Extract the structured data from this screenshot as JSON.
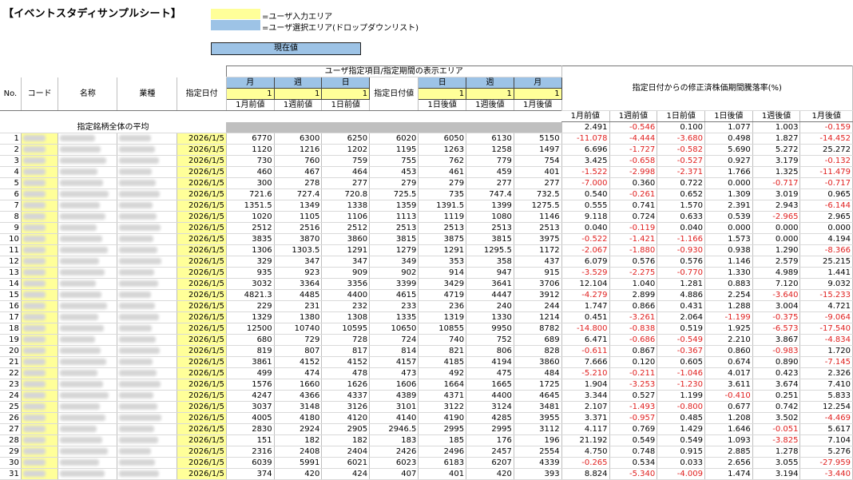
{
  "title": "【イベントスタディサンプルシート】",
  "legend": {
    "input_label": "=ユーザ入力エリア",
    "select_label": "=ユーザ選択エリア(ドロップダウンリスト)",
    "input_color": "#ffff99",
    "select_color": "#9dc3e6"
  },
  "current_button": "現在値",
  "header": {
    "area_title": "ユーザ指定項目/指定期間の表示エリア",
    "rate_title": "指定日付からの修正済株価期間騰落率(%)",
    "no": "No.",
    "code": "コード",
    "name": "名称",
    "industry": "業種",
    "date": "指定日付",
    "date_value": "指定日付値",
    "before_units": [
      "月",
      "週",
      "日"
    ],
    "after_units": [
      "日",
      "週",
      "月"
    ],
    "before_inputs": [
      "1",
      "1",
      "1"
    ],
    "after_inputs": [
      "1",
      "1",
      "1"
    ],
    "before_labels": [
      "1月前値",
      "1週前値",
      "1日前値"
    ],
    "after_labels": [
      "1日後値",
      "1週後値",
      "1月後値"
    ],
    "rate_labels": [
      "1月前値",
      "1週前値",
      "1日前値",
      "1日後値",
      "1週後値",
      "1月後値"
    ]
  },
  "average": {
    "label": "指定銘柄全体の平均",
    "rates": [
      "2.491",
      "-0.546",
      "0.100",
      "1.077",
      "1.003",
      "-0.159"
    ]
  },
  "rows": [
    {
      "no": "1",
      "date": "2026/1/5",
      "vals": [
        "6770",
        "6300",
        "6250",
        "6020",
        "6050",
        "6130",
        "5150"
      ],
      "rates": [
        "-11.078",
        "-4.444",
        "-3.680",
        "0.498",
        "1.827",
        "-14.452"
      ]
    },
    {
      "no": "2",
      "date": "2026/1/5",
      "vals": [
        "1120",
        "1216",
        "1202",
        "1195",
        "1263",
        "1258",
        "1497"
      ],
      "rates": [
        "6.696",
        "-1.727",
        "-0.582",
        "5.690",
        "5.272",
        "25.272"
      ]
    },
    {
      "no": "3",
      "date": "2026/1/5",
      "vals": [
        "730",
        "760",
        "759",
        "755",
        "762",
        "779",
        "754"
      ],
      "rates": [
        "3.425",
        "-0.658",
        "-0.527",
        "0.927",
        "3.179",
        "-0.132"
      ]
    },
    {
      "no": "4",
      "date": "2026/1/5",
      "vals": [
        "460",
        "467",
        "464",
        "453",
        "461",
        "459",
        "401"
      ],
      "rates": [
        "-1.522",
        "-2.998",
        "-2.371",
        "1.766",
        "1.325",
        "-11.479"
      ]
    },
    {
      "no": "5",
      "date": "2026/1/5",
      "vals": [
        "300",
        "278",
        "277",
        "279",
        "279",
        "277",
        "277"
      ],
      "rates": [
        "-7.000",
        "0.360",
        "0.722",
        "0.000",
        "-0.717",
        "-0.717"
      ]
    },
    {
      "no": "6",
      "date": "2026/1/5",
      "vals": [
        "721.6",
        "727.4",
        "720.8",
        "725.5",
        "735",
        "747.4",
        "732.5"
      ],
      "rates": [
        "0.540",
        "-0.261",
        "0.652",
        "1.309",
        "3.019",
        "0.965"
      ]
    },
    {
      "no": "7",
      "date": "2026/1/5",
      "vals": [
        "1351.5",
        "1349",
        "1338",
        "1359",
        "1391.5",
        "1399",
        "1275.5"
      ],
      "rates": [
        "0.555",
        "0.741",
        "1.570",
        "2.391",
        "2.943",
        "-6.144"
      ]
    },
    {
      "no": "8",
      "date": "2026/1/5",
      "vals": [
        "1020",
        "1105",
        "1106",
        "1113",
        "1119",
        "1080",
        "1146"
      ],
      "rates": [
        "9.118",
        "0.724",
        "0.633",
        "0.539",
        "-2.965",
        "2.965"
      ]
    },
    {
      "no": "9",
      "date": "2026/1/5",
      "vals": [
        "2512",
        "2516",
        "2512",
        "2513",
        "2513",
        "2513",
        "2513"
      ],
      "rates": [
        "0.040",
        "-0.119",
        "0.040",
        "0.000",
        "0.000",
        "0.000"
      ]
    },
    {
      "no": "10",
      "date": "2026/1/5",
      "vals": [
        "3835",
        "3870",
        "3860",
        "3815",
        "3875",
        "3815",
        "3975"
      ],
      "rates": [
        "-0.522",
        "-1.421",
        "-1.166",
        "1.573",
        "0.000",
        "4.194"
      ]
    },
    {
      "no": "11",
      "date": "2026/1/5",
      "vals": [
        "1306",
        "1303.5",
        "1291",
        "1279",
        "1291",
        "1295.5",
        "1172"
      ],
      "rates": [
        "-2.067",
        "-1.880",
        "-0.930",
        "0.938",
        "1.290",
        "-8.366"
      ]
    },
    {
      "no": "12",
      "date": "2026/1/5",
      "vals": [
        "329",
        "347",
        "347",
        "349",
        "353",
        "358",
        "437"
      ],
      "rates": [
        "6.079",
        "0.576",
        "0.576",
        "1.146",
        "2.579",
        "25.215"
      ]
    },
    {
      "no": "13",
      "date": "2026/1/5",
      "vals": [
        "935",
        "923",
        "909",
        "902",
        "914",
        "947",
        "915"
      ],
      "rates": [
        "-3.529",
        "-2.275",
        "-0.770",
        "1.330",
        "4.989",
        "1.441"
      ]
    },
    {
      "no": "14",
      "date": "2026/1/5",
      "vals": [
        "3032",
        "3364",
        "3356",
        "3399",
        "3429",
        "3641",
        "3706"
      ],
      "rates": [
        "12.104",
        "1.040",
        "1.281",
        "0.883",
        "7.120",
        "9.032"
      ]
    },
    {
      "no": "15",
      "date": "2026/1/5",
      "vals": [
        "4821.3",
        "4485",
        "4400",
        "4615",
        "4719",
        "4447",
        "3912"
      ],
      "rates": [
        "-4.279",
        "2.899",
        "4.886",
        "2.254",
        "-3.640",
        "-15.233"
      ]
    },
    {
      "no": "16",
      "date": "2026/1/5",
      "vals": [
        "229",
        "231",
        "232",
        "233",
        "236",
        "240",
        "244"
      ],
      "rates": [
        "1.747",
        "0.866",
        "0.431",
        "1.288",
        "3.004",
        "4.721"
      ]
    },
    {
      "no": "17",
      "date": "2026/1/5",
      "vals": [
        "1329",
        "1380",
        "1308",
        "1335",
        "1319",
        "1330",
        "1214"
      ],
      "rates": [
        "0.451",
        "-3.261",
        "2.064",
        "-1.199",
        "-0.375",
        "-9.064"
      ]
    },
    {
      "no": "18",
      "date": "2026/1/5",
      "vals": [
        "12500",
        "10740",
        "10595",
        "10650",
        "10855",
        "9950",
        "8782"
      ],
      "rates": [
        "-14.800",
        "-0.838",
        "0.519",
        "1.925",
        "-6.573",
        "-17.540"
      ]
    },
    {
      "no": "19",
      "date": "2026/1/5",
      "vals": [
        "680",
        "729",
        "728",
        "724",
        "740",
        "752",
        "689"
      ],
      "rates": [
        "6.471",
        "-0.686",
        "-0.549",
        "2.210",
        "3.867",
        "-4.834"
      ]
    },
    {
      "no": "20",
      "date": "2026/1/5",
      "vals": [
        "819",
        "807",
        "817",
        "814",
        "821",
        "806",
        "828"
      ],
      "rates": [
        "-0.611",
        "0.867",
        "-0.367",
        "0.860",
        "-0.983",
        "1.720"
      ]
    },
    {
      "no": "21",
      "date": "2026/1/5",
      "vals": [
        "3861",
        "4152",
        "4152",
        "4157",
        "4185",
        "4194",
        "3860"
      ],
      "rates": [
        "7.666",
        "0.120",
        "0.605",
        "0.674",
        "0.890",
        "-7.145"
      ]
    },
    {
      "no": "22",
      "date": "2026/1/5",
      "vals": [
        "499",
        "474",
        "478",
        "473",
        "492",
        "475",
        "484"
      ],
      "rates": [
        "-5.210",
        "-0.211",
        "-1.046",
        "4.017",
        "0.423",
        "2.326"
      ]
    },
    {
      "no": "23",
      "date": "2026/1/5",
      "vals": [
        "1576",
        "1660",
        "1626",
        "1606",
        "1664",
        "1665",
        "1725"
      ],
      "rates": [
        "1.904",
        "-3.253",
        "-1.230",
        "3.611",
        "3.674",
        "7.410"
      ]
    },
    {
      "no": "24",
      "date": "2026/1/5",
      "vals": [
        "4247",
        "4366",
        "4337",
        "4389",
        "4371",
        "4400",
        "4645"
      ],
      "rates": [
        "3.344",
        "0.527",
        "1.199",
        "-0.410",
        "0.251",
        "5.833"
      ]
    },
    {
      "no": "25",
      "date": "2026/1/5",
      "vals": [
        "3037",
        "3148",
        "3126",
        "3101",
        "3122",
        "3124",
        "3481"
      ],
      "rates": [
        "2.107",
        "-1.493",
        "-0.800",
        "0.677",
        "0.742",
        "12.254"
      ]
    },
    {
      "no": "26",
      "date": "2026/1/5",
      "vals": [
        "4005",
        "4180",
        "4120",
        "4140",
        "4190",
        "4285",
        "3955"
      ],
      "rates": [
        "3.371",
        "-0.957",
        "0.485",
        "1.208",
        "3.502",
        "-4.469"
      ]
    },
    {
      "no": "27",
      "date": "2026/1/5",
      "vals": [
        "2830",
        "2924",
        "2905",
        "2946.5",
        "2995",
        "2995",
        "3112"
      ],
      "rates": [
        "4.117",
        "0.769",
        "1.429",
        "1.646",
        "-0.051",
        "5.617"
      ]
    },
    {
      "no": "28",
      "date": "2026/1/5",
      "vals": [
        "151",
        "182",
        "182",
        "183",
        "185",
        "176",
        "196"
      ],
      "rates": [
        "21.192",
        "0.549",
        "0.549",
        "1.093",
        "-3.825",
        "7.104"
      ]
    },
    {
      "no": "29",
      "date": "2026/1/5",
      "vals": [
        "2316",
        "2408",
        "2404",
        "2426",
        "2496",
        "2457",
        "2554"
      ],
      "rates": [
        "4.750",
        "0.748",
        "0.915",
        "2.885",
        "1.278",
        "5.276"
      ]
    },
    {
      "no": "30",
      "date": "2026/1/5",
      "vals": [
        "6039",
        "5991",
        "6021",
        "6023",
        "6183",
        "6207",
        "4339"
      ],
      "rates": [
        "-0.265",
        "0.534",
        "0.033",
        "2.656",
        "3.055",
        "-27.959"
      ]
    },
    {
      "no": "31",
      "date": "2026/1/5",
      "vals": [
        "374",
        "420",
        "424",
        "407",
        "401",
        "420",
        "393"
      ],
      "rates": [
        "8.824",
        "-5.340",
        "-4.009",
        "1.474",
        "3.194",
        "-3.440"
      ]
    }
  ]
}
